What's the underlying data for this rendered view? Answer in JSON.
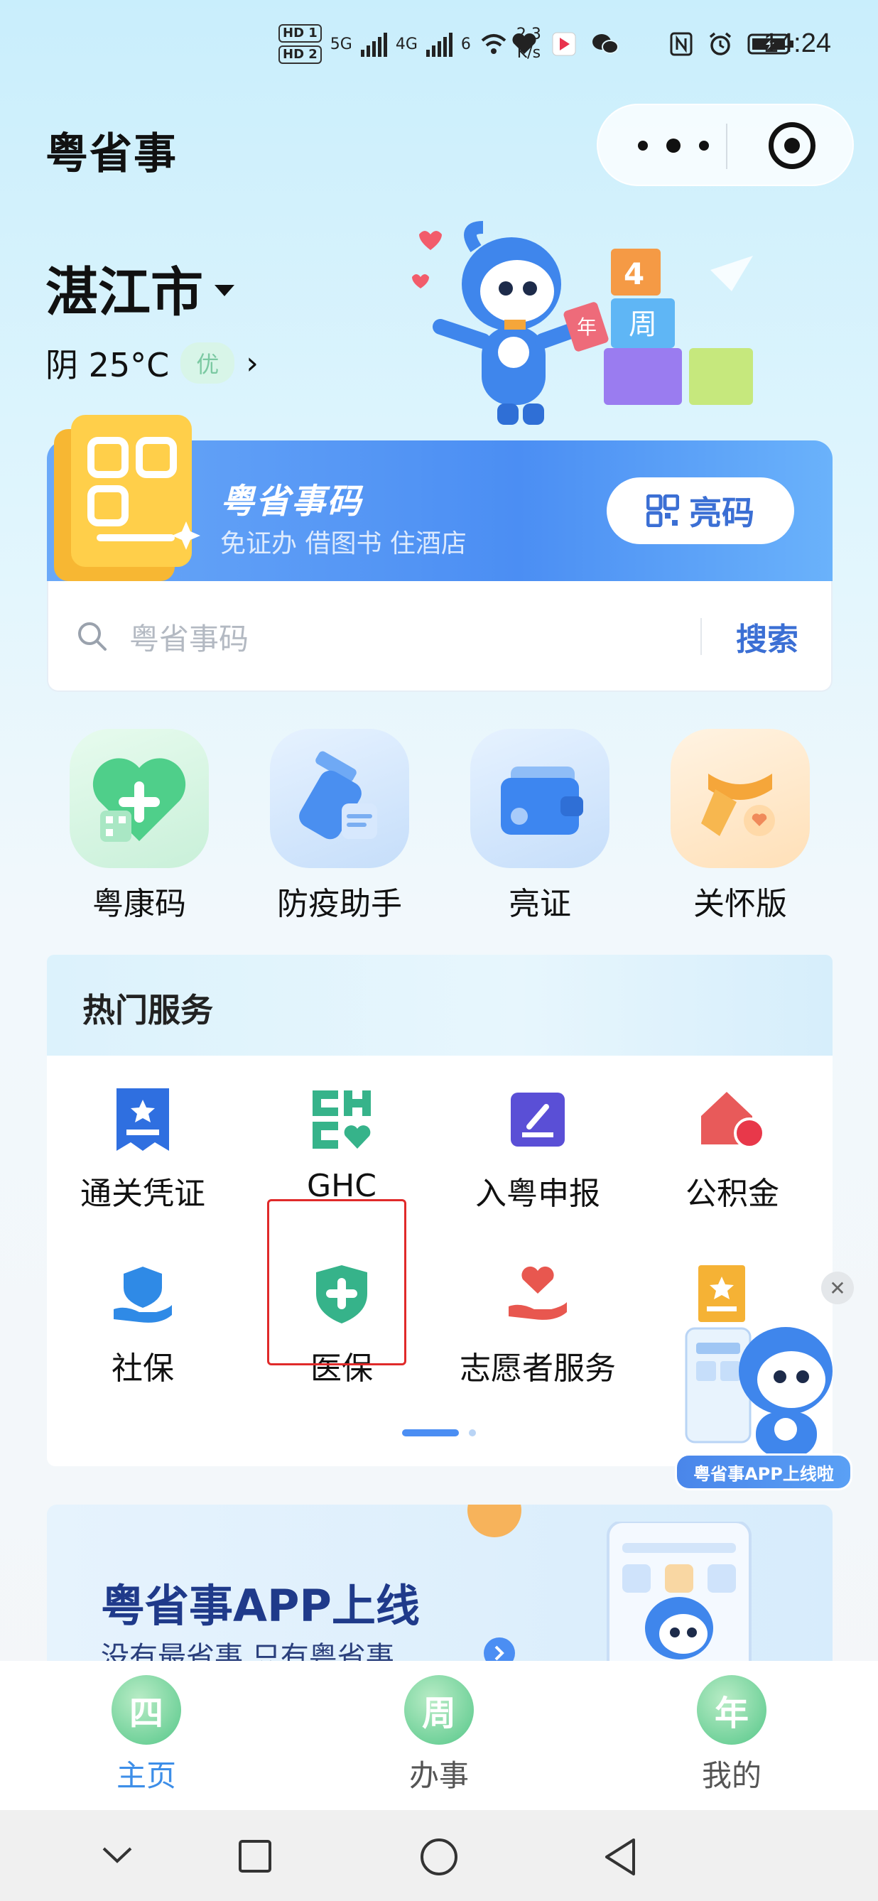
{
  "status_bar": {
    "hd1": "HD 1",
    "hd2": "HD 2",
    "net1": "5G",
    "net2": "4G",
    "wifi_gen": "6",
    "speed_value": "2.3",
    "speed_unit": "K/s",
    "time": "14:24"
  },
  "app": {
    "title": "粤省事"
  },
  "location": {
    "city": "湛江市",
    "weather": "阴 25°C",
    "aqi": "优"
  },
  "code_card": {
    "title": "粤省事码",
    "subtitle": "免证办 借图书 住酒店",
    "show_button": "亮码"
  },
  "search": {
    "placeholder": "粤省事码",
    "button": "搜索"
  },
  "quick_entries": [
    {
      "label": "粤康码",
      "icon": "health-code-icon",
      "color": "#4fcf8a"
    },
    {
      "label": "防疫助手",
      "icon": "epidemic-assistant-icon",
      "color": "#4a8ff0"
    },
    {
      "label": "亮证",
      "icon": "card-wallet-icon",
      "color": "#3d86f0"
    },
    {
      "label": "关怀版",
      "icon": "care-scarf-icon",
      "color": "#f5a63a"
    }
  ],
  "hot_services": {
    "title": "热门服务",
    "items": [
      {
        "label": "通关凭证",
        "icon": "customs-voucher-icon",
        "color": "#2f6fe0"
      },
      {
        "label": "GHC",
        "icon": "ghc-icon",
        "color": "#36b38a"
      },
      {
        "label": "入粤申报",
        "icon": "declare-edit-icon",
        "color": "#5a4fd6"
      },
      {
        "label": "公积金",
        "icon": "housing-fund-icon",
        "color": "#e85a5a"
      },
      {
        "label": "社保",
        "icon": "social-security-icon",
        "color": "#2f8ae6"
      },
      {
        "label": "医保",
        "icon": "medical-insurance-icon",
        "color": "#36b38a"
      },
      {
        "label": "志愿者服务",
        "icon": "volunteer-heart-icon",
        "color": "#e8574f"
      }
    ]
  },
  "floating_promo": {
    "tag": "粤省事APP上线啦"
  },
  "banner": {
    "title": "粤省事APP上线",
    "subtitle": "没有最省事 只有粤省事"
  },
  "tabbar": [
    {
      "label": "主页",
      "badge": "四",
      "active": true
    },
    {
      "label": "办事",
      "badge": "周",
      "active": false
    },
    {
      "label": "我的",
      "badge": "年",
      "active": false
    }
  ],
  "colors": {
    "accent": "#3b6fd4",
    "highlight_box": "#e02a2a",
    "tab_active": "#3d8ee8",
    "tab_inactive": "#555555"
  }
}
